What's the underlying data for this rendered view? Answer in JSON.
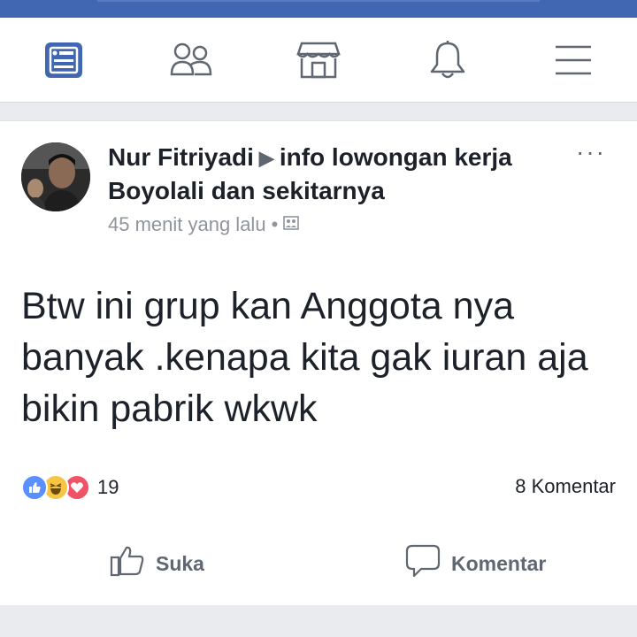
{
  "nav": {
    "items": [
      {
        "name": "news-feed-icon",
        "active": true
      },
      {
        "name": "friends-icon",
        "active": false
      },
      {
        "name": "marketplace-icon",
        "active": false
      },
      {
        "name": "notifications-icon",
        "active": false
      },
      {
        "name": "menu-icon",
        "active": false
      }
    ],
    "active_color": "#4267b2",
    "inactive_color": "#606770"
  },
  "post": {
    "author": "Nur Fitriyadi",
    "group": "info lowongan kerja Boyolali dan sekitarnya",
    "time": "45 menit yang lalu",
    "privacy_icon": "group-privacy-icon",
    "text": "Btw ini grup kan Anggota nya banyak .kenapa kita gak iuran aja bikin pabrik wkwk",
    "reactions": {
      "types": [
        "like",
        "haha",
        "love"
      ],
      "count": "19"
    },
    "comments_count": "8 Komentar",
    "actions": {
      "like_label": "Suka",
      "comment_label": "Komentar"
    }
  }
}
